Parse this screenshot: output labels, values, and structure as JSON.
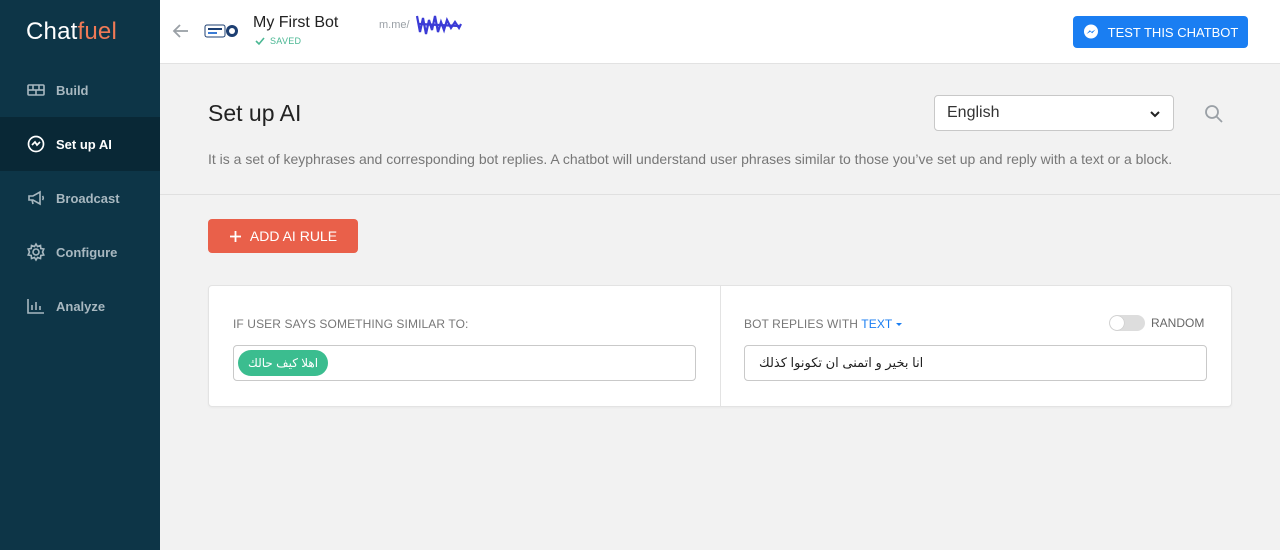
{
  "sidebar": {
    "logo_part1": "Chat",
    "logo_part2": "fuel",
    "items": [
      {
        "label": "Build"
      },
      {
        "label": "Set up AI"
      },
      {
        "label": "Broadcast"
      },
      {
        "label": "Configure"
      },
      {
        "label": "Analyze"
      }
    ]
  },
  "header": {
    "bot_name": "My First Bot",
    "status": "SAVED",
    "link_prefix": "m.me/",
    "test_button": "TEST THIS CHATBOT"
  },
  "page": {
    "title": "Set up AI",
    "language": "English",
    "description": "It is a set of keyphrases and corresponding bot replies. A chatbot will understand user phrases similar to those you’ve set up and reply with a text or a block.",
    "add_button": "ADD AI RULE"
  },
  "rule": {
    "user_says_label": "IF USER SAYS SOMETHING SIMILAR TO:",
    "keyphrase": "اهلا كيف حالك",
    "bot_replies_label": "BOT REPLIES WITH",
    "reply_type": "TEXT",
    "random_label": "RANDOM",
    "random_enabled": false,
    "reply_text": "انا بخير و اتمنى ان تكونوا كذلك"
  },
  "colors": {
    "sidebar_bg": "#0d3547",
    "sidebar_active_bg": "#092836",
    "accent_orange": "#e9604a",
    "accent_blue": "#1a7ef2",
    "chip_green": "#3bbd8f"
  }
}
